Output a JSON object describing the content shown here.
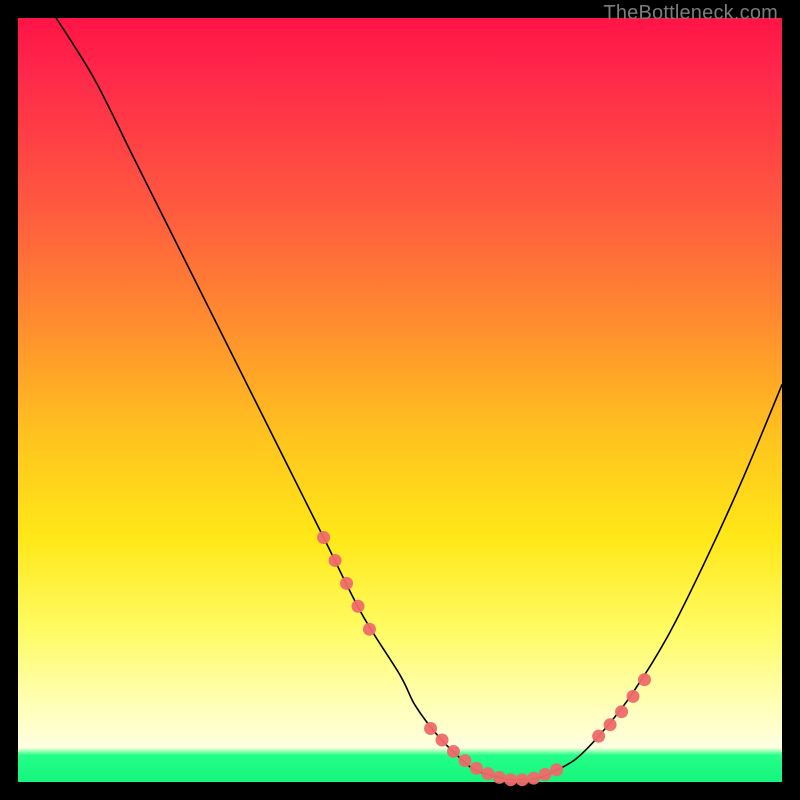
{
  "watermark": "TheBottleneck.com",
  "colors": {
    "gradient_top": "#ff1446",
    "gradient_mid1": "#ff8d2f",
    "gradient_mid2": "#ffe818",
    "gradient_mid3": "#ffffb8",
    "gradient_bottom": "#17f57d",
    "curve": "#000000",
    "markers": "#ef6a6a",
    "frame": "#000000"
  },
  "chart_data": {
    "type": "line",
    "title": "",
    "xlabel": "",
    "ylabel": "",
    "xlim": [
      0,
      100
    ],
    "ylim": [
      0,
      100
    ],
    "grid": false,
    "legend": false,
    "annotations": [
      "TheBottleneck.com"
    ],
    "series": [
      {
        "name": "bottleneck-curve",
        "x": [
          5,
          10,
          15,
          20,
          25,
          30,
          35,
          40,
          45,
          50,
          52,
          55,
          58,
          60,
          63,
          65,
          68,
          70,
          73,
          76,
          80,
          85,
          90,
          95,
          100
        ],
        "y": [
          100,
          92,
          82,
          72,
          62,
          52,
          42,
          32,
          22,
          14,
          10,
          6,
          3,
          1.5,
          0.6,
          0.3,
          0.5,
          1.3,
          3,
          6,
          11,
          19,
          29,
          40,
          52
        ]
      }
    ],
    "markers": {
      "name": "highlighted-region",
      "x": [
        40,
        41.5,
        43,
        44.5,
        46,
        54,
        55.5,
        57,
        58.5,
        60,
        61.5,
        63,
        64.5,
        66,
        67.5,
        69,
        70.5,
        76,
        77.5,
        79,
        80.5,
        82
      ],
      "y": [
        32,
        29,
        26,
        23,
        20,
        7,
        5.5,
        4,
        2.8,
        1.8,
        1.1,
        0.6,
        0.3,
        0.3,
        0.5,
        1.0,
        1.6,
        6,
        7.5,
        9.2,
        11.2,
        13.4
      ]
    }
  }
}
